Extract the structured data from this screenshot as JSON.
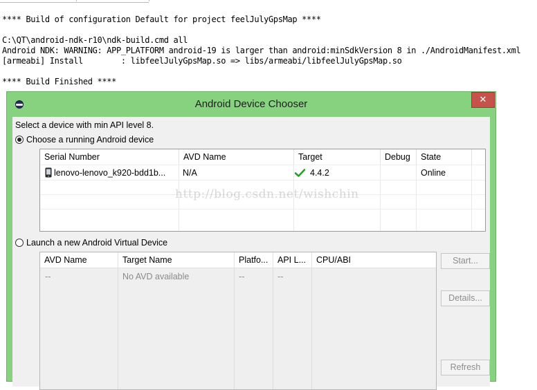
{
  "console": {
    "lines": [
      "**** Build of configuration Default for project feelJulyGpsMap ****",
      "",
      "C:\\QT\\android-ndk-r10\\ndk-build.cmd all",
      "Android NDK: WARNING: APP_PLATFORM android-19 is larger than android:minSdkVersion 8 in ./AndroidManifest.xml",
      "[armeabi] Install        : libfeelJulyGpsMap.so => libs/armeabi/libfeelJulyGpsMap.so",
      "",
      "**** Build Finished ****"
    ]
  },
  "dialog": {
    "title": "Android Device Chooser",
    "close_glyph": "✕",
    "prompt": "Select a device with min API level 8.",
    "choose_running_label": "Choose a running Android device",
    "launch_new_label": "Launch a new Android Virtual Device",
    "running_table": {
      "columns": [
        "Serial Number",
        "AVD Name",
        "Target",
        "Debug",
        "State"
      ],
      "rows": [
        {
          "serial": "lenovo-lenovo_k920-bdd1b...",
          "avd": "N/A",
          "target": "4.4.2",
          "debug": "",
          "state": "Online"
        }
      ]
    },
    "avd_table": {
      "columns": [
        "AVD Name",
        "Target Name",
        "Platfo...",
        "API L...",
        "CPU/ABI"
      ],
      "rows": [
        {
          "avd": "--",
          "target": "No AVD available",
          "platform": "--",
          "api": "--",
          "cpu": ""
        }
      ]
    },
    "buttons": {
      "start": "Start...",
      "details": "Details...",
      "refresh": "Refresh"
    }
  },
  "watermark": "http://blog.csdn.net/wishchin",
  "colors": {
    "titlebar": "#87d27f",
    "close": "#c7514b",
    "check": "#2aa02a"
  },
  "icons": [
    "app-icon",
    "close-icon",
    "phone-icon",
    "checkmark-icon"
  ]
}
